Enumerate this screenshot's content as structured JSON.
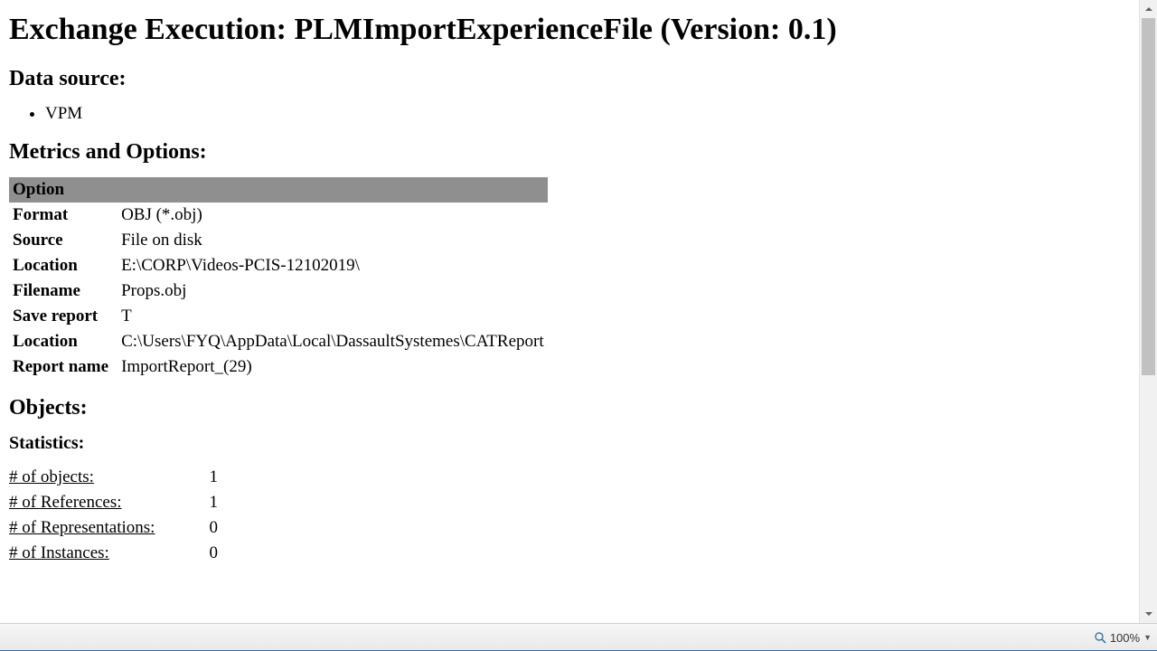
{
  "page_title": "Exchange Execution: PLMImportExperienceFile (Version: 0.1)",
  "sections": {
    "data_source_heading": "Data source:",
    "data_source_items": [
      "VPM"
    ],
    "metrics_heading": "Metrics and Options:",
    "options_header": "Option",
    "options_rows": [
      {
        "label": "Format",
        "value": "OBJ (*.obj)"
      },
      {
        "label": "Source",
        "value": "File on disk"
      },
      {
        "label": "Location",
        "value": "E:\\CORP\\Videos-PCIS-12102019\\"
      },
      {
        "label": "Filename",
        "value": "Props.obj"
      },
      {
        "label": "Save report",
        "value": "T"
      },
      {
        "label": "Location",
        "value": "C:\\Users\\FYQ\\AppData\\Local\\DassaultSystemes\\CATReport"
      },
      {
        "label": "Report name",
        "value": "ImportReport_(29)"
      }
    ],
    "objects_heading": "Objects:",
    "statistics_heading": "Statistics:",
    "statistics_rows": [
      {
        "label": "# of objects:",
        "value": "1"
      },
      {
        "label": "# of References:",
        "value": "1"
      },
      {
        "label": "# of Representations:",
        "value": "0"
      },
      {
        "label": "# of Instances:",
        "value": "0"
      }
    ]
  },
  "statusbar": {
    "zoom_label": "100%"
  }
}
